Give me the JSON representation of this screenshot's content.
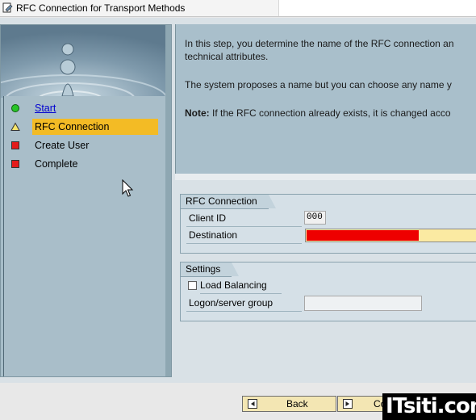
{
  "window": {
    "title": "RFC Connection for Transport Methods"
  },
  "steps": [
    {
      "label": "Start",
      "state": "done",
      "icon": "green-circle-icon",
      "link": true
    },
    {
      "label": "RFC Connection",
      "state": "current",
      "icon": "yellow-triangle-icon"
    },
    {
      "label": "Create User",
      "state": "pending",
      "icon": "red-square-icon"
    },
    {
      "label": "Complete",
      "state": "pending",
      "icon": "red-square-icon"
    }
  ],
  "info": {
    "line1": "In this step, you determine the name of the RFC connection an",
    "line2": "technical attributes.",
    "line3": "The system proposes a name but you can choose any name y",
    "note_label": "Note:",
    "note_text": " If the RFC connection already exists, it is changed acco"
  },
  "rfc_group": {
    "title": "RFC Connection",
    "client_id_label": "Client ID",
    "client_id_value": "000",
    "destination_label": "Destination",
    "destination_value": ""
  },
  "settings_group": {
    "title": "Settings",
    "load_balancing_label": "Load Balancing",
    "load_balancing_checked": false,
    "logon_group_label": "Logon/server group",
    "logon_group_value": ""
  },
  "buttons": {
    "back": "Back",
    "continue": "Co"
  },
  "watermark": "ITsiti.com",
  "colors": {
    "current_step": "#f3bb25",
    "required_field": "#fbeaa2",
    "error_fill": "#ee0000",
    "button_bg": "#f3e6b3",
    "panel_bg": "#a9bfcb"
  }
}
